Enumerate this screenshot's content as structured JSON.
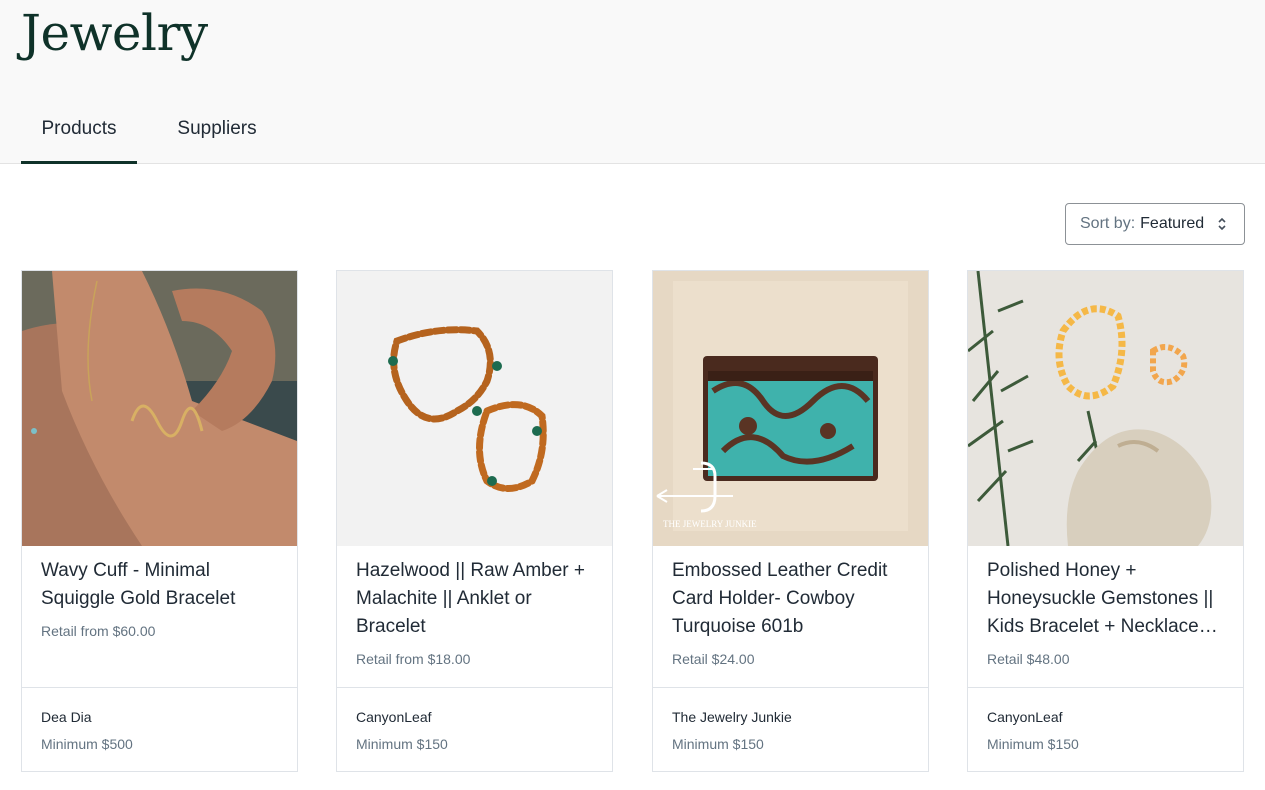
{
  "page": {
    "title": "Jewelry"
  },
  "tabs": [
    {
      "label": "Products",
      "active": true
    },
    {
      "label": "Suppliers",
      "active": false
    }
  ],
  "sort": {
    "prefix": "Sort by:",
    "value": "Featured"
  },
  "products": [
    {
      "title": "Wavy Cuff - Minimal Squiggle Gold Bracelet",
      "price": "Retail from $60.00",
      "supplier": "Dea Dia",
      "minimum": "Minimum $500"
    },
    {
      "title": "Hazelwood || Raw Amber + Malachite || Anklet or Bracelet",
      "price": "Retail from $18.00",
      "supplier": "CanyonLeaf",
      "minimum": "Minimum $150"
    },
    {
      "title": "Embossed Leather Credit Card Holder- Cowboy Turquoise 601b",
      "price": "Retail $24.00",
      "supplier": "The Jewelry Junkie",
      "minimum": "Minimum $150",
      "image_text": "THE JEWELRY JUNKIE"
    },
    {
      "title": "Polished Honey + Honeysuckle Gemstones || Kids Bracelet + Necklace…",
      "price": "Retail $48.00",
      "supplier": "CanyonLeaf",
      "minimum": "Minimum $150"
    }
  ],
  "colors": {
    "brand_dark_green": "#0f3229",
    "muted_text": "#637381",
    "border": "#dfe3e8"
  }
}
